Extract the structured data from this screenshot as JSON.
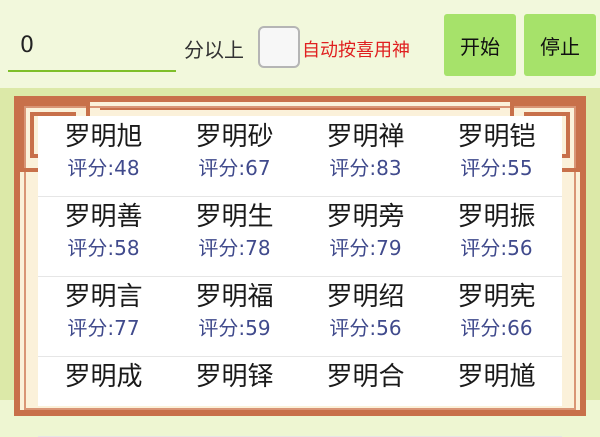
{
  "toolbar": {
    "score_value": "0",
    "above_label": "分以上",
    "auto_label": "自动按喜用神",
    "start_label": "开始",
    "stop_label": "停止"
  },
  "names": [
    [
      {
        "name": "罗明旭",
        "score": "评分:48"
      },
      {
        "name": "罗明砂",
        "score": "评分:67"
      },
      {
        "name": "罗明禅",
        "score": "评分:83"
      },
      {
        "name": "罗明铠",
        "score": "评分:55"
      }
    ],
    [
      {
        "name": "罗明善",
        "score": "评分:58"
      },
      {
        "name": "罗明生",
        "score": "评分:78"
      },
      {
        "name": "罗明旁",
        "score": "评分:79"
      },
      {
        "name": "罗明振",
        "score": "评分:56"
      }
    ],
    [
      {
        "name": "罗明言",
        "score": "评分:77"
      },
      {
        "name": "罗明福",
        "score": "评分:59"
      },
      {
        "name": "罗明绍",
        "score": "评分:56"
      },
      {
        "name": "罗明宪",
        "score": "评分:66"
      }
    ],
    [
      {
        "name": "罗明成",
        "score": ""
      },
      {
        "name": "罗明铎",
        "score": ""
      },
      {
        "name": "罗明合",
        "score": ""
      },
      {
        "name": "罗明馗",
        "score": ""
      }
    ]
  ],
  "colors": {
    "accent_green": "#a6e26a",
    "frame_red": "#c8704a",
    "score_blue": "#404a8c",
    "auto_label_red": "#e02020"
  }
}
